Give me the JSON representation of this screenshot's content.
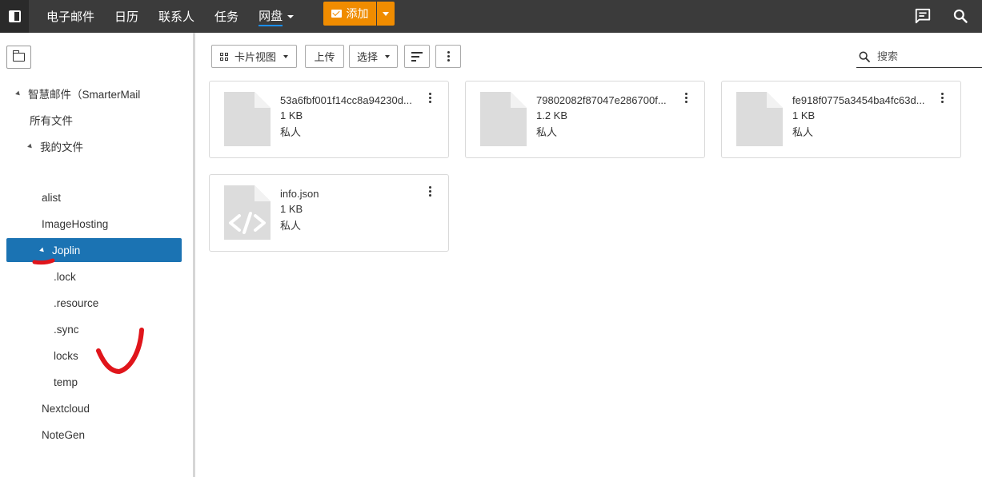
{
  "topbar": {
    "nav": [
      "电子邮件",
      "日历",
      "联系人",
      "任务",
      "网盘"
    ],
    "active_nav": "网盘",
    "add_label": "添加"
  },
  "sidebar": {
    "tree": [
      {
        "label": "智慧邮件（SmarterMail",
        "level": 0,
        "expanded": true
      },
      {
        "label": "所有文件",
        "level": 1
      },
      {
        "label": "我的文件",
        "level": 1,
        "expanded": true
      },
      {
        "label": "alist",
        "level": 2
      },
      {
        "label": "ImageHosting",
        "level": 2
      },
      {
        "label": "Joplin",
        "level": 2,
        "expanded": true,
        "selected": true
      },
      {
        "label": ".lock",
        "level": 3
      },
      {
        "label": ".resource",
        "level": 3
      },
      {
        "label": ".sync",
        "level": 3
      },
      {
        "label": "locks",
        "level": 3
      },
      {
        "label": "temp",
        "level": 3
      },
      {
        "label": "Nextcloud",
        "level": 2
      },
      {
        "label": "NoteGen",
        "level": 2
      }
    ]
  },
  "toolbar": {
    "view_label": "卡片视图",
    "upload_label": "上传",
    "select_label": "选择",
    "search_placeholder": "搜索"
  },
  "files": [
    {
      "name": "53a6fbf001f14cc8a94230d...",
      "size": "1 KB",
      "privacy": "私人",
      "icon": "file-icon"
    },
    {
      "name": "79802082f87047e286700f...",
      "size": "1.2 KB",
      "privacy": "私人",
      "icon": "file-icon"
    },
    {
      "name": "fe918f0775a3454ba4fc63d...",
      "size": "1 KB",
      "privacy": "私人",
      "icon": "file-icon"
    },
    {
      "name": "info.json",
      "size": "1 KB",
      "privacy": "私人",
      "icon": "code-file-icon"
    }
  ],
  "colors": {
    "topbar": "#3b3b3b",
    "accent_add": "#f08c00",
    "selected": "#1b73b3",
    "annotation": "#e0151b"
  }
}
